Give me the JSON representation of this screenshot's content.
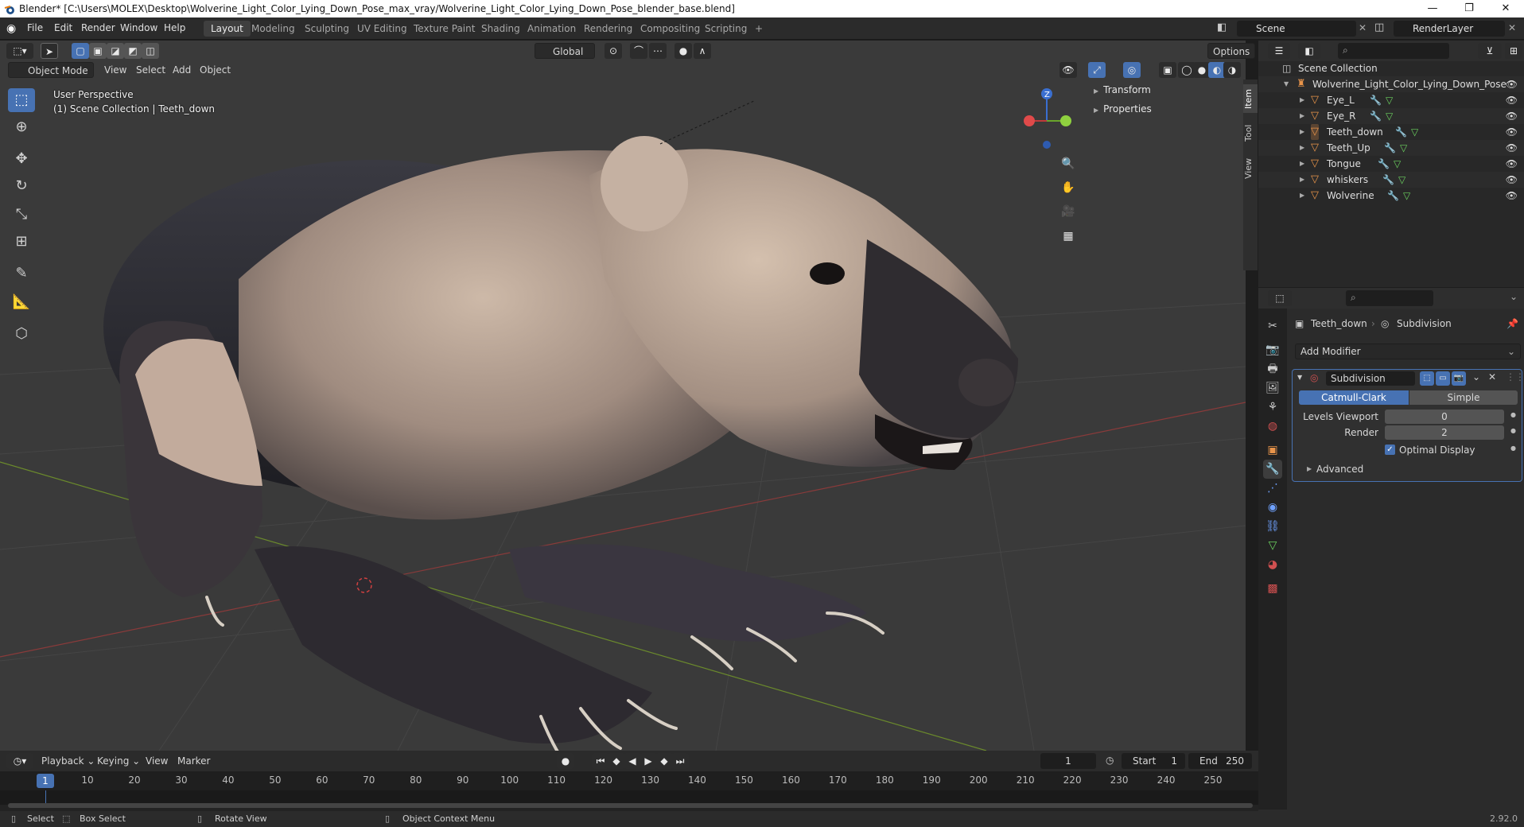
{
  "titlebar": {
    "title": "Blender* [C:\\Users\\MOLEX\\Desktop\\Wolverine_Light_Color_Lying_Down_Pose_max_vray/Wolverine_Light_Color_Lying_Down_Pose_blender_base.blend]",
    "minimize": "—",
    "maximize": "❐",
    "close": "✕"
  },
  "menubar": {
    "menus": [
      "File",
      "Edit",
      "Render",
      "Window",
      "Help"
    ],
    "workspaces": [
      "Layout",
      "Modeling",
      "Sculpting",
      "UV Editing",
      "Texture Paint",
      "Shading",
      "Animation",
      "Rendering",
      "Compositing",
      "Scripting"
    ],
    "add_workspace": "+",
    "scene": "Scene",
    "render_layer": "RenderLayer"
  },
  "viewport": {
    "mode": "Object Mode",
    "menus": [
      "View",
      "Select",
      "Add",
      "Object"
    ],
    "transform_orientation": "Global",
    "options": "Options",
    "info_line1": "User Perspective",
    "info_line2": "(1) Scene Collection | Teeth_down",
    "gizmo_z": "Z",
    "npanel": {
      "transform": "Transform",
      "properties": "Properties"
    },
    "side_tabs": [
      "Item",
      "Tool",
      "View"
    ]
  },
  "outliner": {
    "root": "Scene Collection",
    "collection": "Wolverine_Light_Color_Lying_Down_Pose",
    "objects": [
      "Eye_L",
      "Eye_R",
      "Teeth_down",
      "Teeth_Up",
      "Tongue",
      "whiskers",
      "Wolverine"
    ]
  },
  "properties": {
    "object_name": "Teeth_down",
    "modifier_crumb": "Subdivision",
    "add_modifier": "Add Modifier",
    "modifier": {
      "name": "Subdivision",
      "type_a": "Catmull-Clark",
      "type_b": "Simple",
      "levels_viewport_label": "Levels Viewport",
      "levels_viewport": "0",
      "render_label": "Render",
      "render": "2",
      "optimal_display": "Optimal Display",
      "advanced": "Advanced"
    }
  },
  "timeline": {
    "menus": [
      "Playback",
      "Keying",
      "View",
      "Marker"
    ],
    "current_frame": "1",
    "start_label": "Start",
    "start": "1",
    "end_label": "End",
    "end": "250",
    "ticks": [
      "1",
      "10",
      "20",
      "30",
      "40",
      "50",
      "60",
      "70",
      "80",
      "90",
      "100",
      "110",
      "120",
      "130",
      "140",
      "150",
      "160",
      "170",
      "180",
      "190",
      "200",
      "210",
      "220",
      "230",
      "240",
      "250"
    ]
  },
  "statusbar": {
    "select": "Select",
    "box_select": "Box Select",
    "rotate_view": "Rotate View",
    "context_menu": "Object Context Menu",
    "version": "2.92.0"
  },
  "colors": {
    "accent_blue": "#4772b3",
    "selection_row": "#334d80",
    "object_orange": "#e8944a",
    "mesh_green": "#6bd15f"
  }
}
